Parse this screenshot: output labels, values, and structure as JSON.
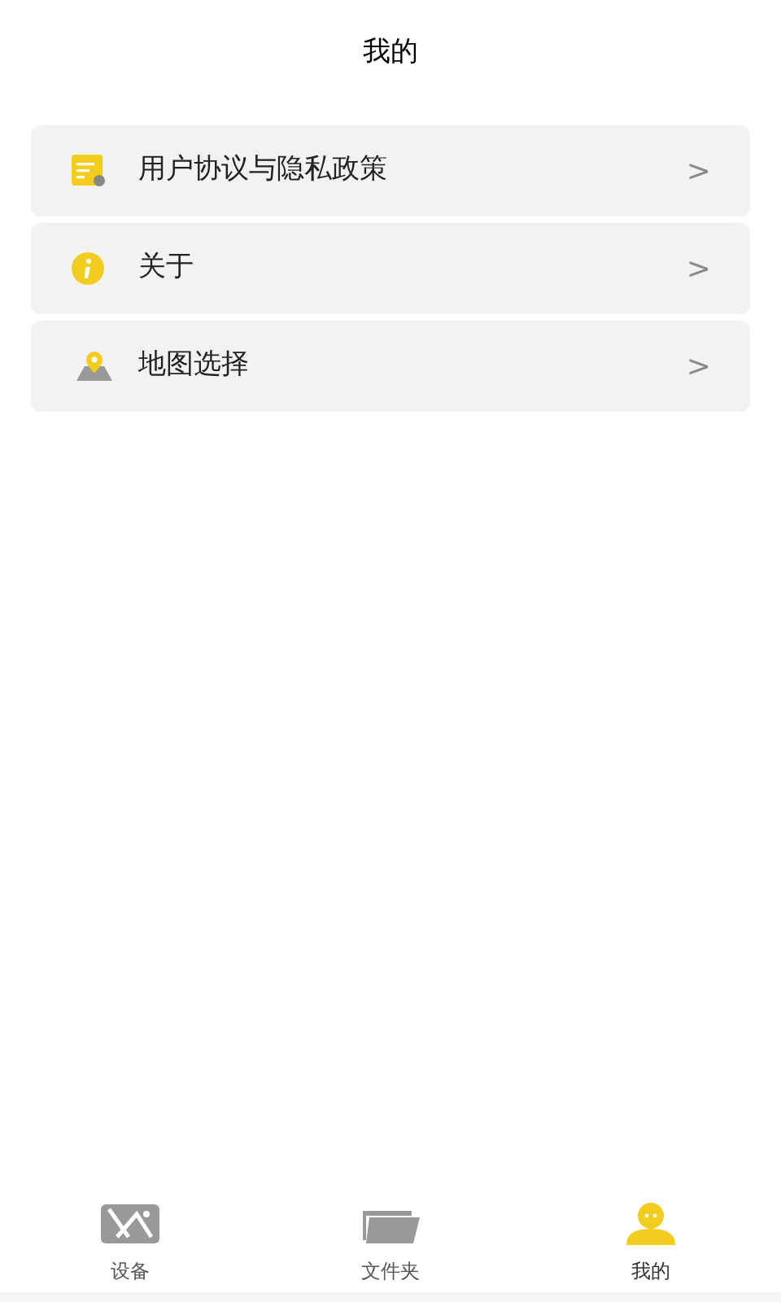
{
  "header": {
    "title": "我的"
  },
  "menu": [
    {
      "kind": "document",
      "label": "用户协议与隐私政策",
      "chevron": ">"
    },
    {
      "kind": "info",
      "label": "关于",
      "chevron": ">"
    },
    {
      "kind": "map",
      "label": "地图选择",
      "chevron": ">"
    }
  ],
  "tabs": [
    {
      "kind": "device",
      "label": "设备",
      "selected": false
    },
    {
      "kind": "folder",
      "label": "文件夹",
      "selected": false
    },
    {
      "kind": "profile",
      "label": "我的",
      "selected": true
    }
  ]
}
